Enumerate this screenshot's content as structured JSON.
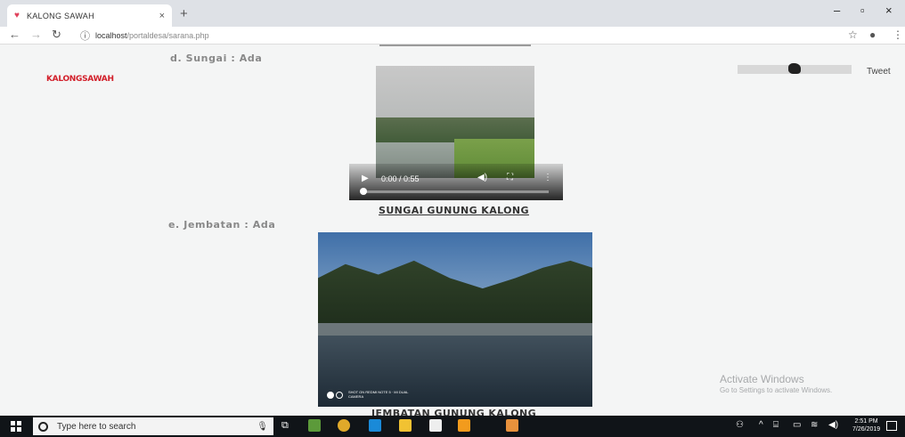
{
  "browser": {
    "tab_title": "KALONG SAWAH",
    "tab_close": "×",
    "new_tab": "+",
    "win_min": "–",
    "win_max": "▫",
    "win_close": "×",
    "url_host": "localhost",
    "url_path": "/portaldesa/sarana.php"
  },
  "page": {
    "logo": "KALONGSAWAH",
    "section_d_label": "d.   Sungai : Ada",
    "video_time": "0:00 / 0:55",
    "caption_d": "SUNGAI GUNUNG KALONG",
    "section_e_label": "e.   Jembatan : Ada",
    "caption_e": "JEMBATAN GUNUNG KALONG",
    "photo_watermark": "SHOT ON REDMI NOTE 5 · MI DUAL CAMERA",
    "tweet": "Tweet",
    "activate_title": "Activate Windows",
    "activate_sub": "Go to Settings to activate Windows."
  },
  "taskbar": {
    "search_placeholder": "Type here to search",
    "time": "2:51 PM",
    "date": "7/26/2019"
  },
  "colors": {
    "logo_red": "#d21f2a",
    "taskbar": "#101418",
    "page_bg": "#f4f5f5"
  }
}
